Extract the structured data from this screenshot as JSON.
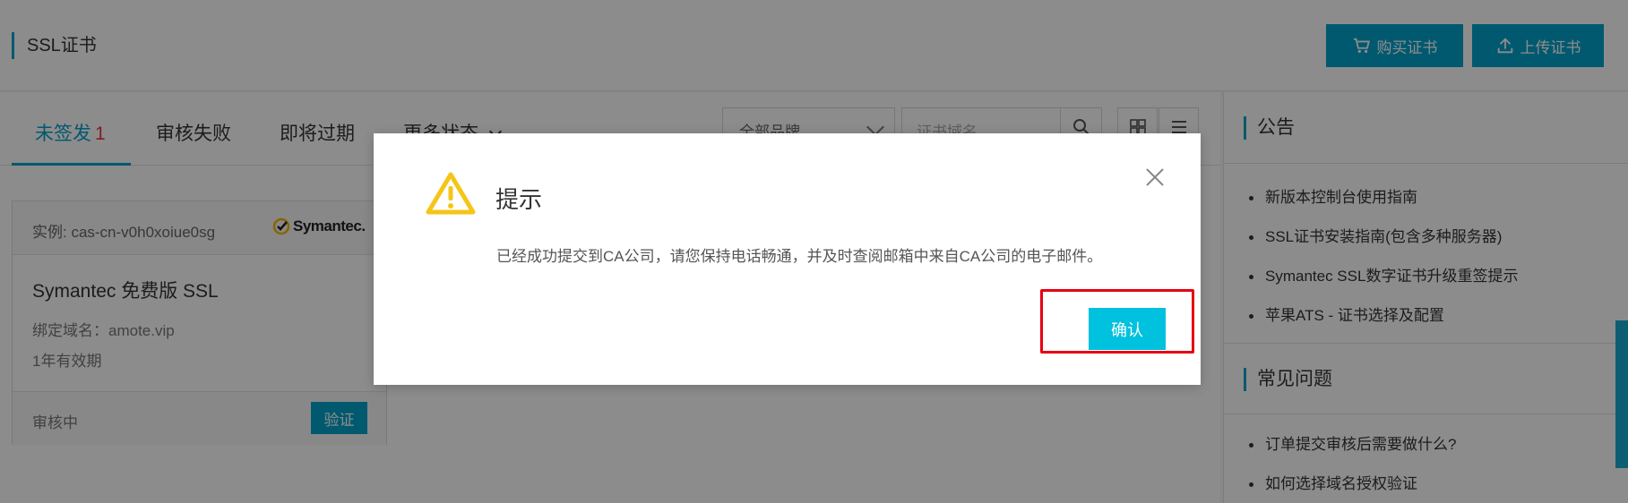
{
  "header": {
    "title": "SSL证书",
    "buy_label": "购买证书",
    "upload_label": "上传证书"
  },
  "tabs": [
    {
      "label": "未签发",
      "count": "1"
    },
    {
      "label": "审核失败"
    },
    {
      "label": "即将过期"
    },
    {
      "label": "更多状态"
    }
  ],
  "filters": {
    "brand": "全部品牌",
    "domain_placeholder": "证书域名"
  },
  "card": {
    "instance": "实例: cas-cn-v0h0xoiue0sg",
    "brand_logo": "Symantec.",
    "name": "Symantec 免费版 SSL",
    "domain": "绑定域名：amote.vip",
    "validity": "1年有效期",
    "status": "审核中",
    "verify_label": "验证"
  },
  "sidebar": {
    "notice_title": "公告",
    "notices": [
      "新版本控制台使用指南",
      "SSL证书安装指南(包含多种服务器)",
      "Symantec SSL数字证书升级重签提示",
      "苹果ATS - 证书选择及配置"
    ],
    "faq_title": "常见问题",
    "faqs": [
      "订单提交审核后需要做什么?",
      "如何选择域名授权验证"
    ]
  },
  "dialog": {
    "title": "提示",
    "message": "已经成功提交到CA公司，请您保持电话畅通，并及时查阅邮箱中来自CA公司的电子邮件。",
    "confirm_label": "确认"
  },
  "colors": {
    "accent": "#00a2ca",
    "confirm": "#00c1de",
    "highlight": "#e60012",
    "warning": "#f5c518"
  }
}
